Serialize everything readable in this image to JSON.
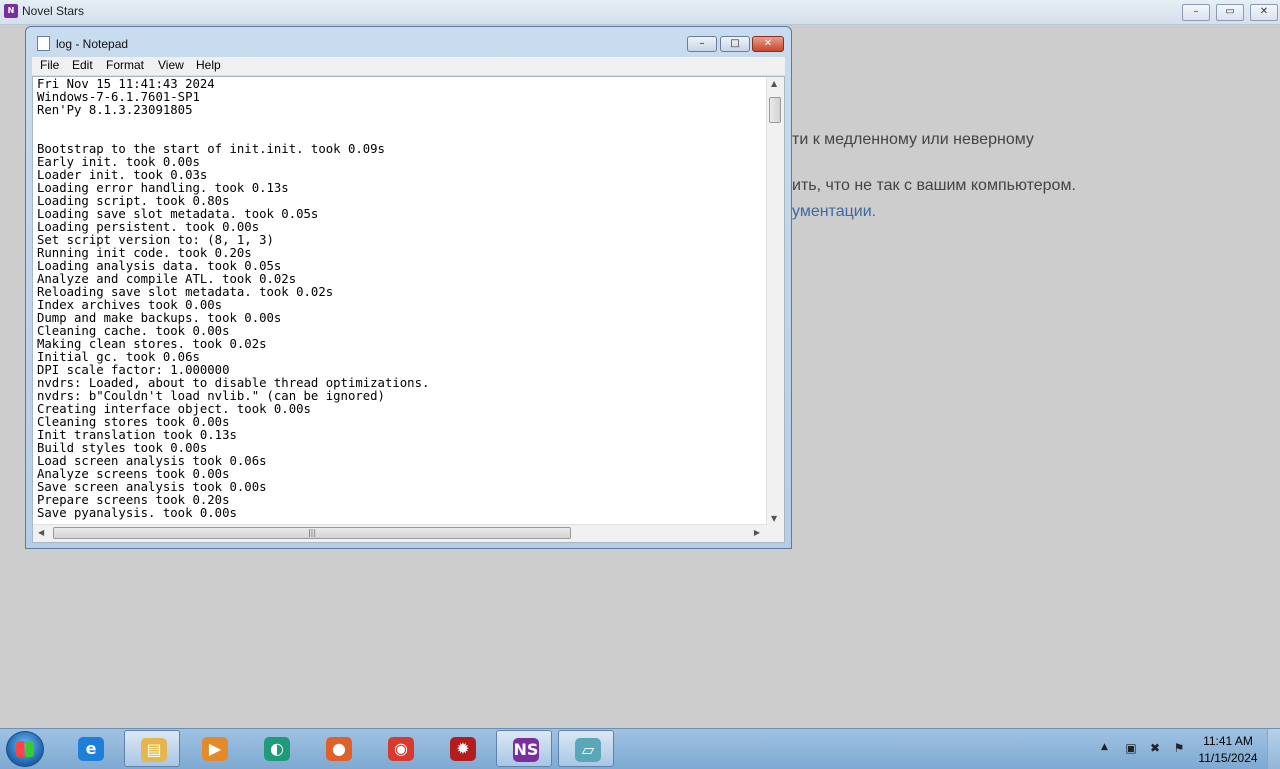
{
  "background_app": {
    "title": "Novel Stars",
    "icon": "novel-stars-icon",
    "text_lines": [
      "ти к медленному или неверному",
      "ить, что не так с вашим компьютером.",
      "ументации."
    ]
  },
  "notepad": {
    "title": "log - Notepad",
    "controls": {
      "minimize": "–",
      "maximize": "□",
      "close": "✕"
    },
    "menu": [
      "File",
      "Edit",
      "Format",
      "View",
      "Help"
    ],
    "content": "Fri Nov 15 11:41:43 2024\nWindows-7-6.1.7601-SP1\nRen'Py 8.1.3.23091805\n\n\nBootstrap to the start of init.init. took 0.09s\nEarly init. took 0.00s\nLoader init. took 0.03s\nLoading error handling. took 0.13s\nLoading script. took 0.80s\nLoading save slot metadata. took 0.05s\nLoading persistent. took 0.00s\nSet script version to: (8, 1, 3)\nRunning init code. took 0.20s\nLoading analysis data. took 0.05s\nAnalyze and compile ATL. took 0.02s\nReloading save slot metadata. took 0.02s\nIndex archives took 0.00s\nDump and make backups. took 0.00s\nCleaning cache. took 0.00s\nMaking clean stores. took 0.02s\nInitial gc. took 0.06s\nDPI scale factor: 1.000000\nnvdrs: Loaded, about to disable thread optimizations.\nnvdrs: b\"Couldn't load nvlib.\" (can be ignored)\nCreating interface object. took 0.00s\nCleaning stores took 0.00s\nInit translation took 0.13s\nBuild styles took 0.00s\nLoad screen analysis took 0.06s\nAnalyze screens took 0.00s\nSave screen analysis took 0.00s\nPrepare screens took 0.20s\nSave pyanalysis. took 0.00s"
  },
  "taskbar": {
    "items": [
      {
        "name": "internet-explorer-icon",
        "glyph": "e",
        "color": "#1e7fd8",
        "active": false
      },
      {
        "name": "file-explorer-icon",
        "glyph": "▤",
        "color": "#e7b64a",
        "active": true
      },
      {
        "name": "media-player-icon",
        "glyph": "▶",
        "color": "#e48a2a",
        "active": false
      },
      {
        "name": "ring-app-icon",
        "glyph": "◐",
        "color": "#1f9b7a",
        "active": false
      },
      {
        "name": "firefox-icon",
        "glyph": "●",
        "color": "#e0602a",
        "active": false
      },
      {
        "name": "chrome-icon",
        "glyph": "◉",
        "color": "#d93a2f",
        "active": false
      },
      {
        "name": "red-gear-app-icon",
        "glyph": "✹",
        "color": "#b31d1d",
        "active": false
      },
      {
        "name": "novel-stars-taskbar-icon",
        "glyph": "NS",
        "color": "#7a2fa0",
        "active": true
      },
      {
        "name": "notepad-taskbar-icon",
        "glyph": "▱",
        "color": "#5aa7b8",
        "active": true
      }
    ],
    "tray": {
      "time": "11:41 AM",
      "date": "11/15/2024"
    }
  }
}
